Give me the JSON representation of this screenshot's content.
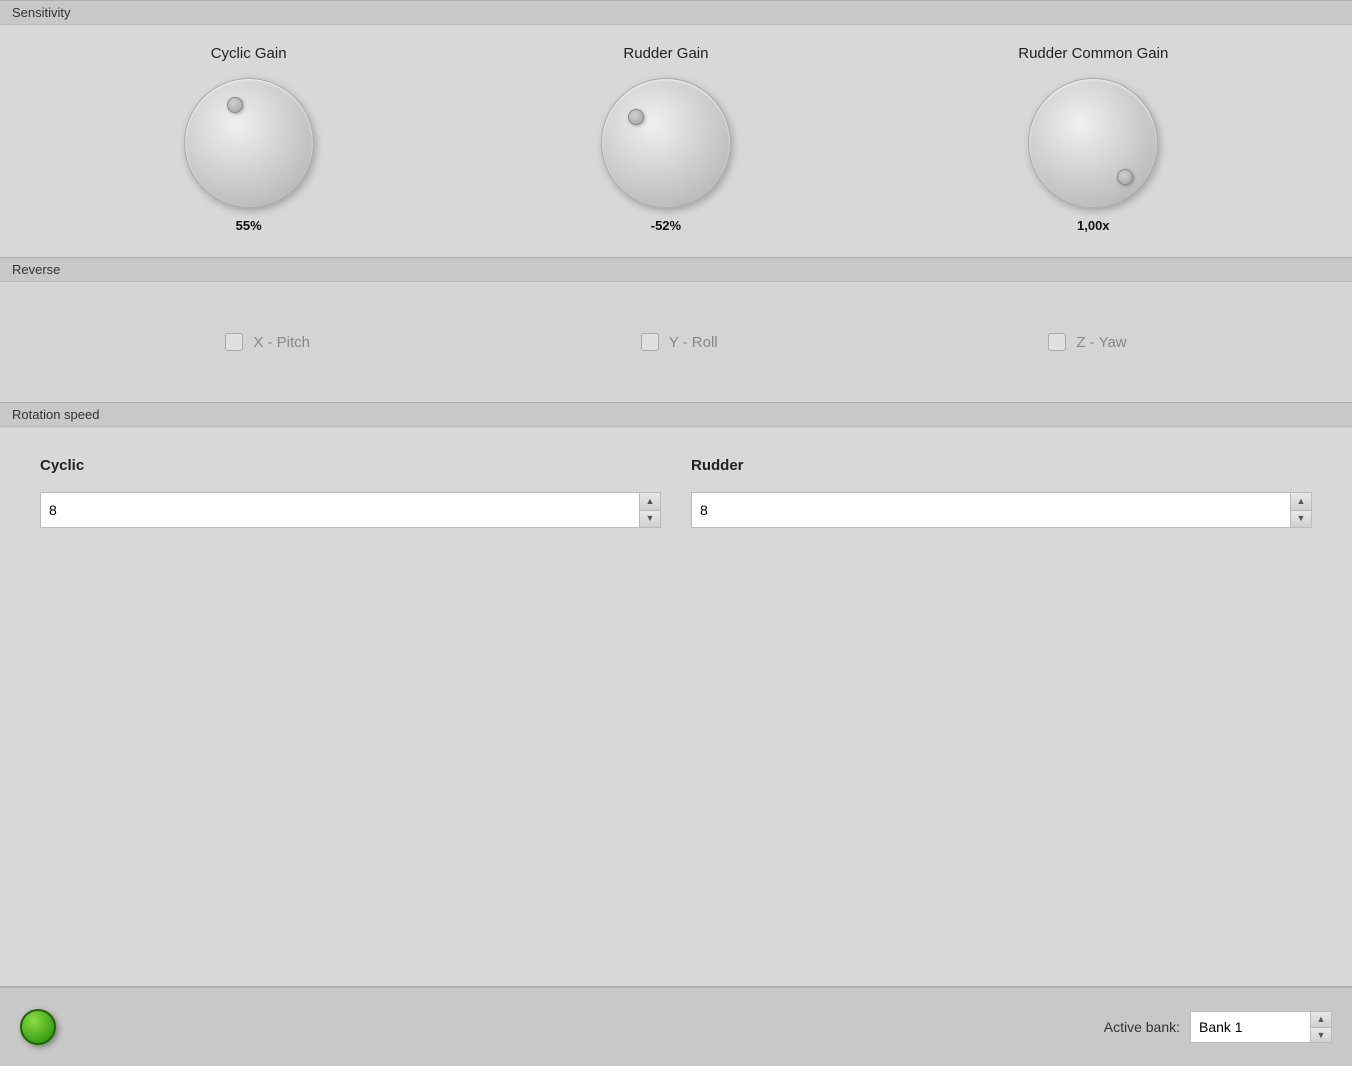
{
  "sensitivity": {
    "header": "Sensitivity",
    "cyclic_gain": {
      "label": "Cyclic Gain",
      "value": "55%"
    },
    "rudder_gain": {
      "label": "Rudder Gain",
      "value": "-52%"
    },
    "rudder_common_gain": {
      "label": "Rudder Common Gain",
      "value": "1,00x"
    }
  },
  "reverse": {
    "header": "Reverse",
    "x_pitch": {
      "label": "X - Pitch",
      "checked": false
    },
    "y_roll": {
      "label": "Y - Roll",
      "checked": false
    },
    "z_yaw": {
      "label": "Z - Yaw",
      "checked": false
    }
  },
  "rotation_speed": {
    "header": "Rotation speed",
    "cyclic": {
      "label": "Cyclic",
      "value": "8"
    },
    "rudder": {
      "label": "Rudder",
      "value": "8"
    }
  },
  "bottom_bar": {
    "active_bank_label": "Active bank:",
    "bank_value": "Bank 1"
  },
  "icons": {
    "chevron_up": "▲",
    "chevron_down": "▼"
  }
}
